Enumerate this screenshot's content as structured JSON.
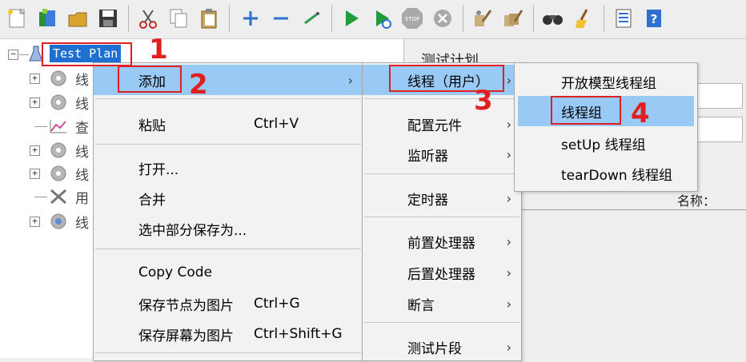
{
  "toolbar": {
    "icons": [
      "new-icon",
      "templates-icon",
      "open-icon",
      "save-icon",
      "cut-icon",
      "copy-icon",
      "paste-icon",
      "expand-icon",
      "collapse-icon",
      "toggle-icon",
      "start-icon",
      "start-no-pause-icon",
      "stop-icon",
      "shutdown-icon",
      "clear-icon",
      "clear-all-icon",
      "search-icon",
      "reset-search-icon",
      "function-helper-icon",
      "help-icon"
    ]
  },
  "tree": {
    "root_label": "Test Plan",
    "children": [
      {
        "label": "线",
        "icon": "gear-icon"
      },
      {
        "label": "线",
        "icon": "gear-icon"
      },
      {
        "label": "查",
        "icon": "graph-icon"
      },
      {
        "label": "线",
        "icon": "gear-icon"
      },
      {
        "label": "线",
        "icon": "gear-icon"
      },
      {
        "label": "用",
        "icon": "tools-icon"
      },
      {
        "label": "线",
        "icon": "gear-icon"
      }
    ]
  },
  "right_panel": {
    "title_partial": "测试计划",
    "name_label": "名称："
  },
  "context_menu": {
    "items": [
      {
        "label": "添加",
        "shortcut": "",
        "submenu": true,
        "selected": true
      },
      {
        "label": "粘贴",
        "shortcut": "Ctrl+V"
      },
      {
        "label": "打开..."
      },
      {
        "label": "合并"
      },
      {
        "label": "选中部分保存为..."
      },
      {
        "label": "Copy Code"
      },
      {
        "label": "保存节点为图片",
        "shortcut": "Ctrl+G"
      },
      {
        "label": "保存屏幕为图片",
        "shortcut": "Ctrl+Shift+G"
      }
    ]
  },
  "add_submenu": {
    "items": [
      {
        "label": "线程（用户）",
        "selected": true
      },
      {
        "label": "配置元件"
      },
      {
        "label": "监听器"
      },
      {
        "label": "定时器"
      },
      {
        "label": "前置处理器"
      },
      {
        "label": "后置处理器"
      },
      {
        "label": "断言"
      },
      {
        "label": "测试片段"
      }
    ]
  },
  "threads_submenu": {
    "items": [
      {
        "label": "开放模型线程组"
      },
      {
        "label": "线程组",
        "selected": true
      },
      {
        "label": "setUp 线程组"
      },
      {
        "label": "tearDown 线程组"
      }
    ]
  },
  "annotations": {
    "step1": "1",
    "step2": "2",
    "step3": "3",
    "step4": "4",
    "color": "#e02020"
  },
  "colors": {
    "menu_highlight": "#99c9f5",
    "tree_selection": "#1f6fd1"
  }
}
